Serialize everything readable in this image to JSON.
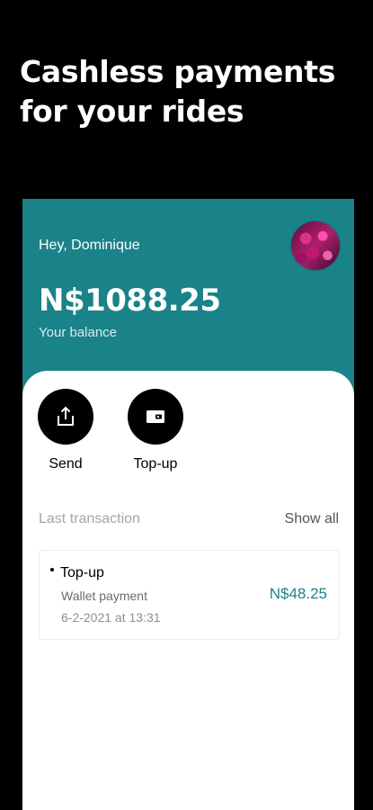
{
  "headline": {
    "line1": "Cashless payments",
    "line2": "for your rides"
  },
  "wallet": {
    "greeting": "Hey, Dominique",
    "balance": "N$1088.25",
    "balance_label": "Your balance",
    "accent_color": "#1a8289"
  },
  "actions": {
    "send_label": "Send",
    "send_icon": "share-upload-icon",
    "topup_label": "Top-up",
    "topup_icon": "wallet-icon"
  },
  "transactions": {
    "section_title": "Last transaction",
    "show_all_label": "Show all",
    "items": [
      {
        "title": "Top-up",
        "subtitle": "Wallet payment",
        "date": "6-2-2021 at 13:31",
        "amount": "N$48.25"
      }
    ]
  }
}
